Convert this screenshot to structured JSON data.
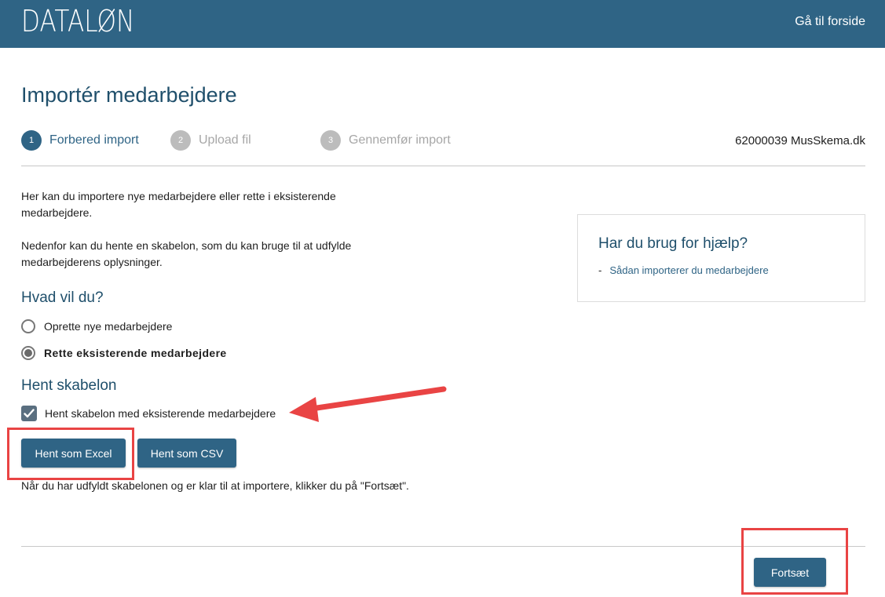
{
  "header": {
    "logo": "DATALØN",
    "home_link": "Gå til forside"
  },
  "page": {
    "title": "Importér medarbejdere",
    "company": "62000039 MusSkema.dk"
  },
  "steps": [
    {
      "number": "1",
      "label": "Forbered import",
      "active": true
    },
    {
      "number": "2",
      "label": "Upload fil",
      "active": false
    },
    {
      "number": "3",
      "label": "Gennemfør import",
      "active": false
    }
  ],
  "intro": {
    "paragraph1": "Her kan du importere nye medarbejdere eller rette i eksisterende medarbejdere.",
    "paragraph2": "Nedenfor kan du hente en skabelon, som du kan bruge til at udfylde medarbejderens oplysninger."
  },
  "action": {
    "title": "Hvad vil du?",
    "options": [
      {
        "label": "Oprette nye medarbejdere",
        "selected": false
      },
      {
        "label": "Rette eksisterende medarbejdere",
        "selected": true
      }
    ]
  },
  "template": {
    "title": "Hent skabelon",
    "checkbox_label": "Hent skabelon med eksisterende medarbejdere",
    "checkbox_checked": true,
    "excel_button": "Hent som Excel",
    "csv_button": "Hent som CSV",
    "hint": "Når du har udfyldt skabelonen og er klar til at importere, klikker du på \"Fortsæt\"."
  },
  "help": {
    "title": "Har du brug for hjælp?",
    "bullet": "-",
    "link": "Sådan importerer du medarbejdere"
  },
  "footer": {
    "continue_button": "Fortsæt"
  },
  "colors": {
    "brand": "#2f6485",
    "annotation": "#e94444"
  }
}
